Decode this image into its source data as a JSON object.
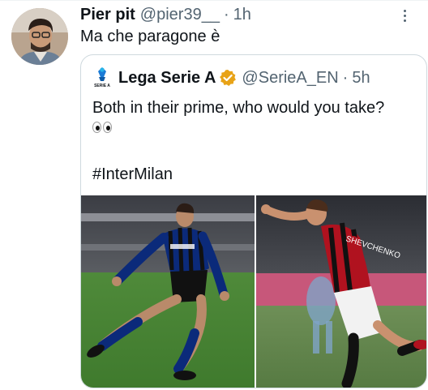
{
  "tweet": {
    "author_name": "Pier pit",
    "handle": "@pier39__",
    "separator": "·",
    "time": "1h",
    "text": "Ma che paragone è",
    "more_icon": "more-horizontal-icon"
  },
  "quoted_tweet": {
    "logo_text": "SERIE A",
    "author_name": "Lega Serie A",
    "verified_icon": "verified-badge-icon",
    "handle": "@SerieA_EN",
    "separator": "·",
    "time": "5h",
    "text": "Both in their prime, who would you take?",
    "emoji": "eyes-emoji",
    "hashtag": "#InterMilan",
    "media": [
      {
        "name": "inter-player-photo"
      },
      {
        "name": "milan-player-photo"
      }
    ]
  },
  "colors": {
    "text": "#0f1419",
    "secondary": "#536471",
    "border": "#cfd9de",
    "verified_gold": "#e8a317"
  }
}
